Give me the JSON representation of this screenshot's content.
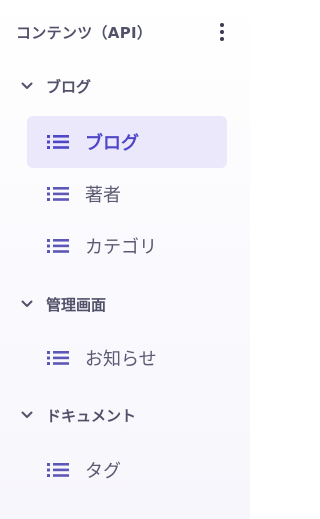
{
  "header": {
    "title": "コンテンツ（API）",
    "menu_icon": "more-vertical-icon"
  },
  "groups": [
    {
      "label": "ブログ",
      "expanded": true,
      "items": [
        {
          "label": "ブログ",
          "active": true
        },
        {
          "label": "著者",
          "active": false
        },
        {
          "label": "カテゴリ",
          "active": false
        }
      ]
    },
    {
      "label": "管理画面",
      "expanded": true,
      "items": [
        {
          "label": "お知らせ",
          "active": false
        }
      ]
    },
    {
      "label": "ドキュメント",
      "expanded": true,
      "items": [
        {
          "label": "タグ",
          "active": false
        }
      ]
    }
  ],
  "colors": {
    "accent": "#4f46c8",
    "active_bg": "#ebe8fb",
    "text": "#5b5a72",
    "icon": "#5d58b8"
  }
}
